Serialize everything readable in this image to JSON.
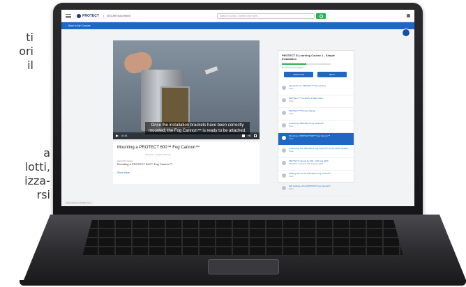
{
  "side_text": {
    "top": [
      "ti",
      "ori",
      "il"
    ],
    "bottom": [
      "a",
      "lotti,",
      "izza-",
      "rsi"
    ]
  },
  "header": {
    "logo": "PROTECT",
    "logo_sub": "SECURE MACHINES",
    "search_placeholder": "Search courses, content and more...",
    "back_link": "Back to My Courses"
  },
  "player": {
    "subtitle": "Once the installation brackets have been correctly mounted, the Fog Cannon™ is ready to be attached.",
    "time": "01:41",
    "quality": "HD"
  },
  "info": {
    "title": "Mounting a PROTECT 600™ Fog Cannon™",
    "instructor": "Instructor: Jonathan Tommy",
    "about_label": "About this lesson",
    "about_text": "Mounting a PROTECT 600™ Fog Cannon™",
    "show_more": "Show more"
  },
  "panel": {
    "title": "PROTECT E-Learning Course 1 - Simple Installation",
    "progress": 0.5,
    "progress_label": "8 / 16 lessons completed",
    "previous": "PREVIOUS",
    "next": "NEXT",
    "lessons": [
      {
        "title": "Introduction to PROTECT™ E-Learning",
        "type": "Video"
      },
      {
        "title": "PROTECT™ Company Profile Video",
        "type": "Video"
      },
      {
        "title": "PROTECT™ Product Range",
        "type": "Video"
      },
      {
        "title": "Unboxing a PROTECT Fog Cannon®",
        "type": "Video"
      },
      {
        "title": "Mounting a PROTECT 600™ Fog Cannon™",
        "type": "Video"
      },
      {
        "title": "Connecting The PROTECT Fog Cannon® To The Alarm System",
        "type": "Video"
      },
      {
        "title": "PROTECT manual for 600, 1100 and 2200",
        "type": "PROTECT manual for 600, 1100 and 2200"
      },
      {
        "title": "Heating time of the PROTECT Fog Cannon®",
        "type": "Video"
      },
      {
        "title": "Self settings of the PROTECT Fog Cannon®",
        "type": "Video"
      }
    ],
    "active_index": 4
  },
  "status_url": "https://protect.thinkific.com"
}
